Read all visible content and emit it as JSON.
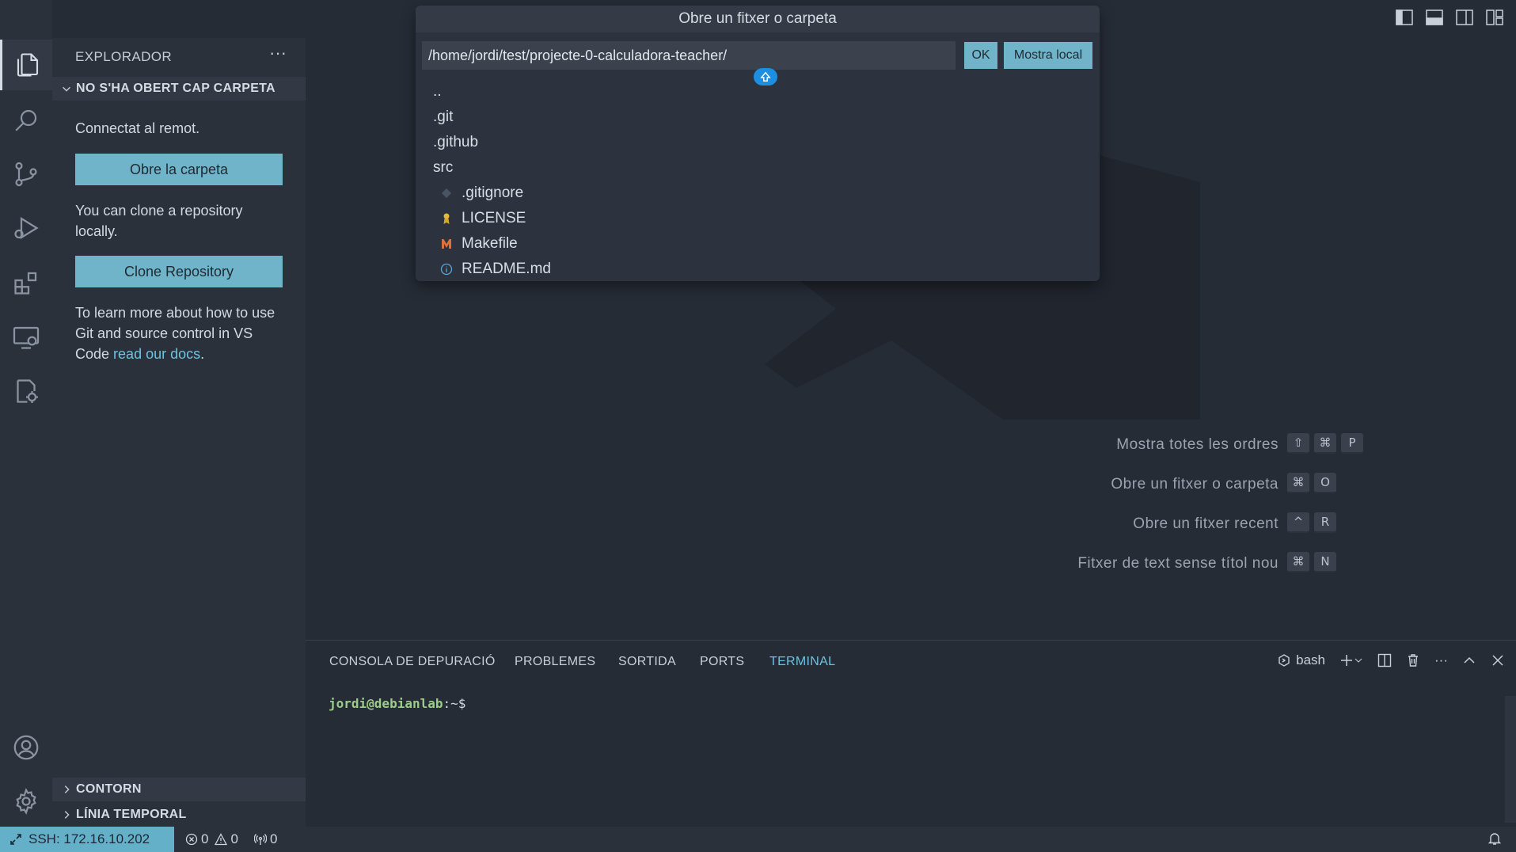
{
  "sidebar": {
    "title": "EXPLORADOR",
    "more_actions": "···",
    "no_folder_section": "NO S'HA OBERT CAP CARPETA",
    "connected_text": "Connectat al remot.",
    "open_folder_button": "Obre la carpeta",
    "clone_text": "You can clone a repository locally.",
    "clone_button": "Clone Repository",
    "learn_text_before": "To learn more about how to use Git and source control in VS Code",
    "learn_link": "read our docs",
    "learn_text_after": ".",
    "outline_section": "CONTORN",
    "timeline_section": "LÍNIA TEMPORAL"
  },
  "quick_pick": {
    "title": "Obre un fitxer o carpeta",
    "input_value": "/home/jordi/test/projecte-0-calculadora-teacher/",
    "ok_button": "OK",
    "show_local_button": "Mostra local",
    "items": [
      {
        "label": "..",
        "icon": ""
      },
      {
        "label": ".git",
        "icon": ""
      },
      {
        "label": ".github",
        "icon": ""
      },
      {
        "label": "src",
        "icon": ""
      },
      {
        "label": ".gitignore",
        "icon": "git-diamond-icon"
      },
      {
        "label": "LICENSE",
        "icon": "license-ribbon-icon"
      },
      {
        "label": "Makefile",
        "icon": "makefile-m-icon"
      },
      {
        "label": "README.md",
        "icon": "info-icon"
      }
    ]
  },
  "shortcuts": [
    {
      "label": "Mostra totes les ordres",
      "keys": [
        "⇧",
        "⌘",
        "P"
      ]
    },
    {
      "label": "Obre un fitxer o carpeta",
      "keys": [
        "⌘",
        "O"
      ]
    },
    {
      "label": "Obre un fitxer recent",
      "keys": [
        "^",
        "R"
      ]
    },
    {
      "label": "Fitxer de text sense títol nou",
      "keys": [
        "⌘",
        "N"
      ]
    }
  ],
  "panel": {
    "tabs": [
      "CONSOLA DE DEPURACIÓ",
      "PROBLEMES",
      "SORTIDA",
      "PORTS",
      "TERMINAL"
    ],
    "active_tab": "TERMINAL",
    "shell_name": "bash",
    "terminal_user": "jordi@debianlab",
    "terminal_path": ":~$"
  },
  "statusbar": {
    "remote": "SSH: 172.16.10.202",
    "errors": "0",
    "warnings": "0",
    "ports": "0"
  },
  "colors": {
    "accent": "#6fb4c9",
    "link": "#6bc4e0",
    "background": "#262c36",
    "sidebar": "#2b313b"
  }
}
